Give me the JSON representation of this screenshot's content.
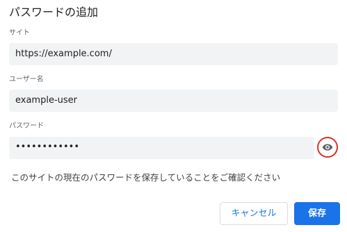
{
  "dialog": {
    "title": "パスワードの追加",
    "site": {
      "label": "サイト",
      "value": "https://example.com/"
    },
    "username": {
      "label": "ユーザー名",
      "value": "example-user"
    },
    "password": {
      "label": "パスワード",
      "value": "••••••••••••",
      "toggle_icon": "eye-icon"
    },
    "note": "このサイトの現在のパスワードを保存していることをご確認ください",
    "buttons": {
      "cancel_label": "キャンセル",
      "save_label": "保存"
    }
  },
  "colors": {
    "accent": "#1a73e8",
    "field_bg": "#f1f3f4",
    "highlight_ring": "#d93025"
  }
}
